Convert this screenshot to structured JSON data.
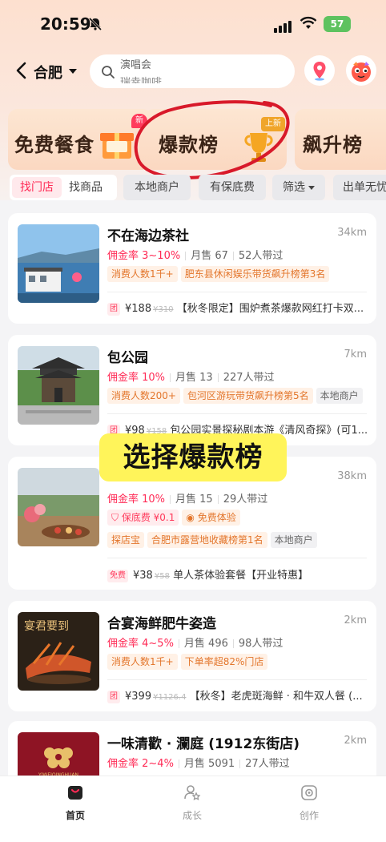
{
  "status_bar": {
    "time": "20:59",
    "battery": "57"
  },
  "header": {
    "city": "合肥",
    "search_line1": "演唱会",
    "search_line2": "瑞幸咖啡"
  },
  "rankings": [
    {
      "label": "免费餐食",
      "badge": "新"
    },
    {
      "label": "爆款榜",
      "badge": "上新"
    },
    {
      "label": "飙升榜"
    }
  ],
  "filters": {
    "segment_active": "找门店",
    "segment_inactive": "找商品",
    "chips": [
      "本地商户",
      "有保底费",
      "筛选",
      "出单无忧"
    ]
  },
  "overlay_caption": "选择爆款榜",
  "stores": [
    {
      "name": "不在海边茶社",
      "distance": "34km",
      "rate": "佣金率 3~10%",
      "sales": "月售 67",
      "promoters": "52人带过",
      "tags": [
        {
          "text": "消费人数1千+",
          "style": "orange"
        },
        {
          "text": "肥东县休闲娱乐带货飙升榜第3名",
          "style": "orange"
        }
      ],
      "deal": {
        "type": "团",
        "price": "¥188",
        "original": "¥310",
        "title": "【秋冬限定】围炉煮茶爆款网红打卡双..."
      }
    },
    {
      "name": "包公园",
      "distance": "7km",
      "rate": "佣金率 10%",
      "sales": "月售 13",
      "promoters": "227人带过",
      "tags": [
        {
          "text": "消费人数200+",
          "style": "orange"
        },
        {
          "text": "包河区游玩带货飙升榜第5名",
          "style": "orange"
        },
        {
          "text": "本地商户",
          "style": "gray"
        }
      ],
      "deal": {
        "type": "团",
        "price": "¥98",
        "original": "¥158",
        "title": "包公园实景探秘剧本游《清风奇探》(可1..."
      }
    },
    {
      "name": "",
      "distance": "38km",
      "rate": "佣金率 10%",
      "sales": "月售 15",
      "promoters": "29人带过",
      "badges": [
        {
          "text": "保底费 ¥0.1",
          "style": "pink"
        },
        {
          "text": "免费体验",
          "style": "orange"
        }
      ],
      "tags": [
        {
          "text": "探店宝",
          "style": "orange"
        },
        {
          "text": "合肥市露营地收藏榜第1名",
          "style": "orange"
        },
        {
          "text": "本地商户",
          "style": "gray"
        }
      ],
      "deal": {
        "type": "免费",
        "price": "¥38",
        "original": "¥58",
        "title": "单人茶体验套餐【开业特惠】"
      }
    },
    {
      "name": "合宴海鲜肥牛姿造",
      "distance": "2km",
      "rate": "佣金率 4~5%",
      "sales": "月售 496",
      "promoters": "98人带过",
      "tags": [
        {
          "text": "消费人数1千+",
          "style": "orange"
        },
        {
          "text": "下单率超82%门店",
          "style": "orange"
        }
      ],
      "deal": {
        "type": "团",
        "price": "¥399",
        "original": "¥1126.4",
        "title": "【秋冬】老虎斑海鲜 · 和牛双人餐 (..."
      },
      "thumb_text": "宴君要到"
    },
    {
      "name": "一味清歡 · 瀾庭 (1912东街店)",
      "distance": "2km",
      "rate": "佣金率 2~4%",
      "sales": "月售 5091",
      "promoters": "27人带过",
      "thumb_text": "YIWEIQINGHUAN"
    }
  ],
  "tabbar": [
    {
      "label": "首页",
      "icon": "home-bag-icon",
      "active": true
    },
    {
      "label": "成长",
      "icon": "growth-icon",
      "active": false
    },
    {
      "label": "创作",
      "icon": "create-camera-icon",
      "active": false
    }
  ],
  "colors": {
    "accent": "#ff2a55",
    "caption_bg": "#fff45a",
    "tag_orange": "#e3762c"
  }
}
